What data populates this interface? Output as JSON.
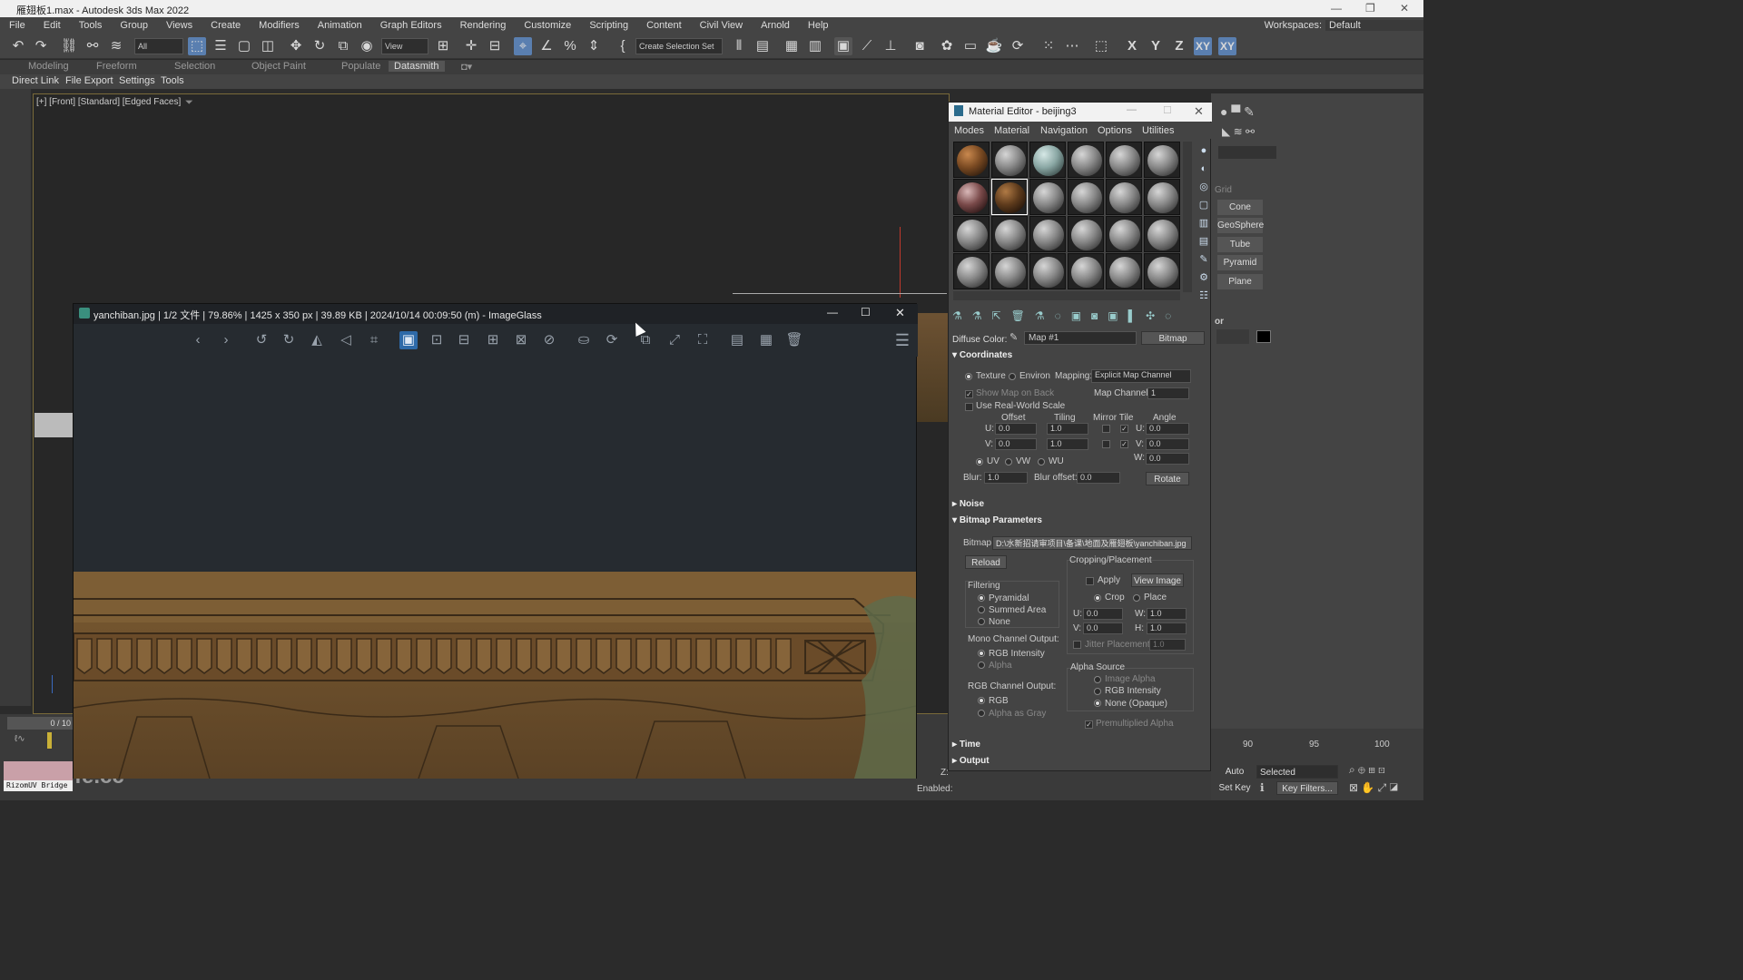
{
  "app": {
    "title": "雁翅板1.max - Autodesk 3ds Max 2022"
  },
  "menu": [
    "File",
    "Edit",
    "Tools",
    "Group",
    "Views",
    "Create",
    "Modifiers",
    "Animation",
    "Graph Editors",
    "Rendering",
    "Customize",
    "Scripting",
    "Content",
    "Civil View",
    "Arnold",
    "Help"
  ],
  "workspace": {
    "label": "Workspaces:",
    "value": "Default"
  },
  "toolbar": {
    "filter_value": "All",
    "view_value": "View",
    "selection_set": "Create Selection Set",
    "axes": [
      "X",
      "Y",
      "Z",
      "XY",
      "XY"
    ]
  },
  "ribbon": {
    "tabs": [
      "Modeling",
      "Freeform",
      "Selection",
      "Object Paint",
      "Populate",
      "Datasmith"
    ],
    "sub": [
      "Direct Link",
      "File Export",
      "Settings",
      "Tools"
    ]
  },
  "viewport": {
    "label": "[+] [Front] [Standard] [Edged Faces]"
  },
  "imageglass": {
    "title": "yanchiban.jpg  |  1/2 文件  |  79.86%  |  1425 x 350 px  |  39.89 KB  |  2024/10/14 00:09:50 (m)  - ImageGlass"
  },
  "material_editor": {
    "title": "Material Editor - beijing3",
    "menu": [
      "Modes",
      "Material",
      "Navigation",
      "Options",
      "Utilities"
    ],
    "diffuse_label": "Diffuse Color:",
    "map_name": "Map #1",
    "map_type": "Bitmap",
    "coordinates": {
      "header": "Coordinates",
      "texture": "Texture",
      "environ": "Environ",
      "mapping_label": "Mapping:",
      "mapping_value": "Explicit Map Channel",
      "show_map_back": "Show Map on Back",
      "map_channel_label": "Map Channel:",
      "map_channel_value": "1",
      "real_world": "Use Real-World Scale",
      "offset": "Offset",
      "tiling": "Tiling",
      "mirror_tile": "Mirror Tile",
      "angle": "Angle",
      "u": "U:",
      "v": "V:",
      "w": "W:",
      "u_offset": "0.0",
      "v_offset": "0.0",
      "u_tiling": "1.0",
      "v_tiling": "1.0",
      "u_angle": "0.0",
      "v_angle": "0.0",
      "w_angle": "0.0",
      "uv": "UV",
      "vw": "VW",
      "wu": "WU",
      "blur_label": "Blur:",
      "blur_value": "1.0",
      "blur_offset_label": "Blur offset:",
      "blur_offset_value": "0.0",
      "rotate": "Rotate"
    },
    "noise_header": "Noise",
    "bitmap_params": {
      "header": "Bitmap Parameters",
      "bitmap_label": "Bitmap:",
      "bitmap_path": "D:\\水新招请审项目\\备课\\地面及雁翅板\\yanchiban.jpg",
      "reload": "Reload",
      "cropping": "Cropping/Placement",
      "apply": "Apply",
      "view_image": "View Image",
      "crop": "Crop",
      "place": "Place",
      "u_val": "0.0",
      "v_val": "0.0",
      "w_val": "1.0",
      "h_val": "1.0",
      "u_label": "U:",
      "v_label": "V:",
      "w_label": "W:",
      "h_label": "H:",
      "jitter": "Jitter Placement:",
      "jitter_val": "1.0",
      "filtering": "Filtering",
      "pyramidal": "Pyramidal",
      "summed": "Summed Area",
      "none": "None",
      "mono": "Mono Channel Output:",
      "rgb_int": "RGB Intensity",
      "alpha": "Alpha",
      "rgb_out": "RGB Channel Output:",
      "rgb": "RGB",
      "alpha_gray": "Alpha as Gray",
      "alpha_src": "Alpha Source",
      "img_alpha": "Image Alpha",
      "rgb_int2": "RGB Intensity",
      "none_opaque": "None (Opaque)",
      "premult": "Premultiplied Alpha"
    },
    "time_header": "Time",
    "output_header": "Output"
  },
  "command_panel": {
    "grid_label": "Grid",
    "buttons": [
      "Cone",
      "GeoSphere",
      "Tube",
      "Pyramid",
      "Plane"
    ],
    "section": "or"
  },
  "timeline": {
    "frame": "0 / 10"
  },
  "bottom": {
    "ticks": [
      "90",
      "95",
      "100"
    ],
    "auto_key": "Auto Key",
    "set_key": "Set Key",
    "selected": "Selected",
    "key_filters": "Key Filters...",
    "enabled": "Enabled:",
    "z_label": "Z:",
    "bridge": "RizomUV Bridge",
    "watermark": "fe.cc"
  },
  "colors": {
    "accent": "#5a7fb0",
    "viewport_border": "#7a6a3a",
    "ig_active": "#2e6aa8"
  }
}
